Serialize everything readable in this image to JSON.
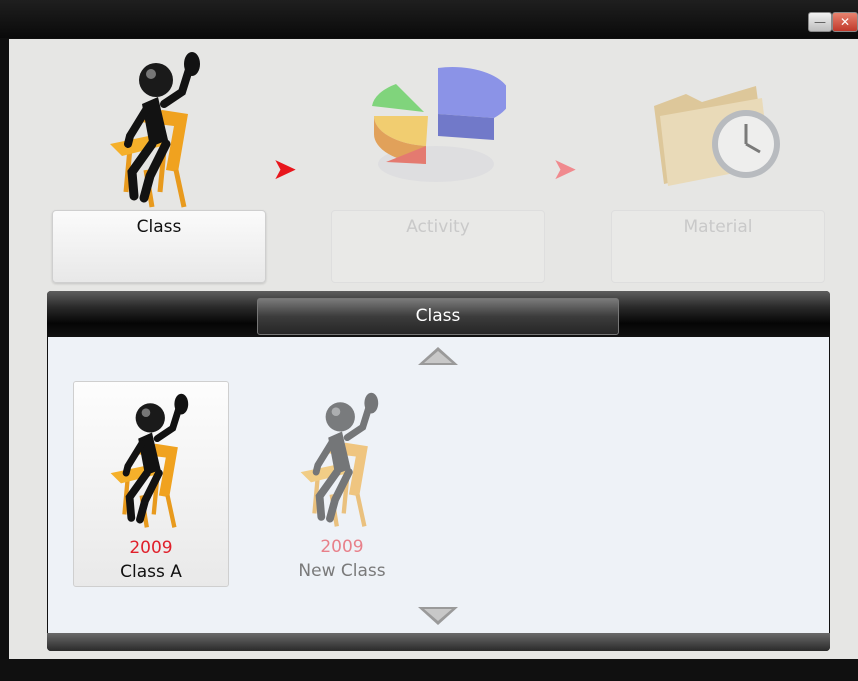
{
  "window": {
    "minimize_icon": "minimize-icon",
    "close_icon": "close-icon"
  },
  "steps": [
    {
      "label": "Class",
      "icon": "student-figure-icon",
      "state": "active"
    },
    {
      "label": "Activity",
      "icon": "pie-chart-icon",
      "state": "disabled"
    },
    {
      "label": "Material",
      "icon": "folder-clock-icon",
      "state": "disabled"
    }
  ],
  "arrows": [
    {
      "icon": "right-arrow-icon",
      "color": "#e8161c"
    },
    {
      "icon": "right-arrow-icon",
      "color": "#f08a8e"
    }
  ],
  "panel": {
    "title": "Class",
    "scroll_up_icon": "scroll-up-icon",
    "scroll_down_icon": "scroll-down-icon",
    "items": [
      {
        "year": "2009",
        "name": "Class A",
        "selected": true
      },
      {
        "year": "2009",
        "name": "New Class",
        "selected": false
      }
    ]
  },
  "colors": {
    "year_text": "#e0202b",
    "accent_arrow": "#e8161c"
  }
}
